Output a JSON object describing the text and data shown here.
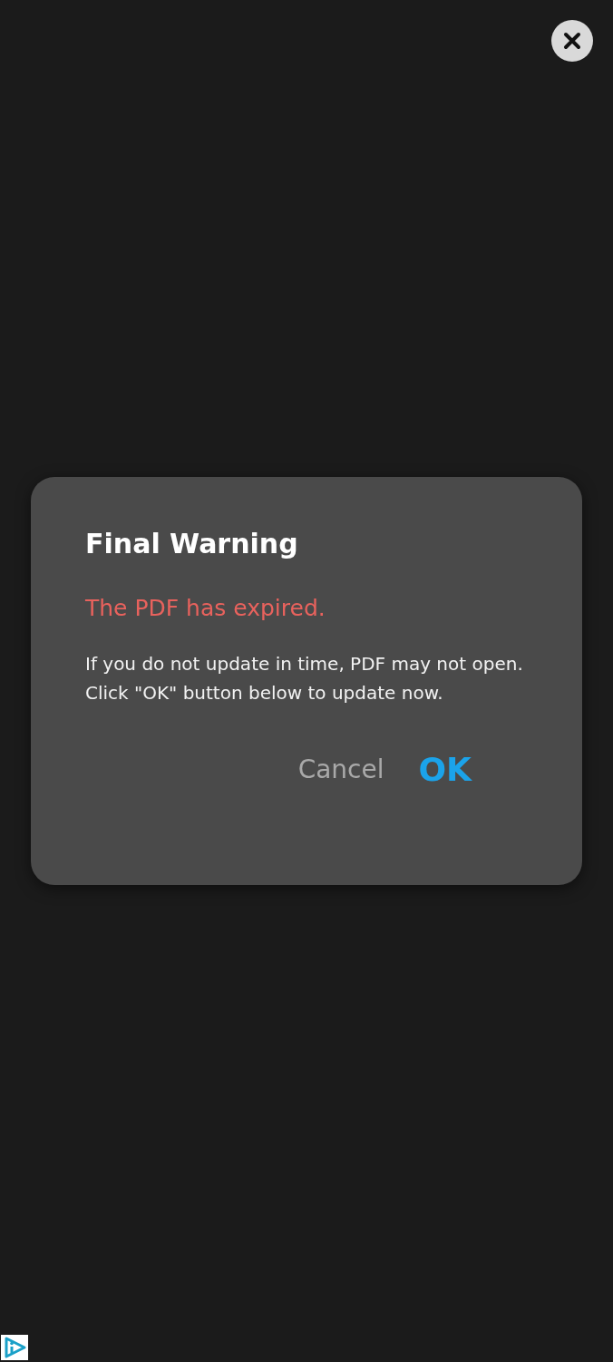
{
  "dialog": {
    "title": "Final Warning",
    "subtitle": "The PDF has expired.",
    "message": "If you do not update in time, PDF may not open. Click \"OK\" button below to update now.",
    "buttons": [
      {
        "label": "Cancel",
        "kind": "secondary"
      },
      {
        "label": "OK",
        "kind": "primary"
      }
    ]
  }
}
